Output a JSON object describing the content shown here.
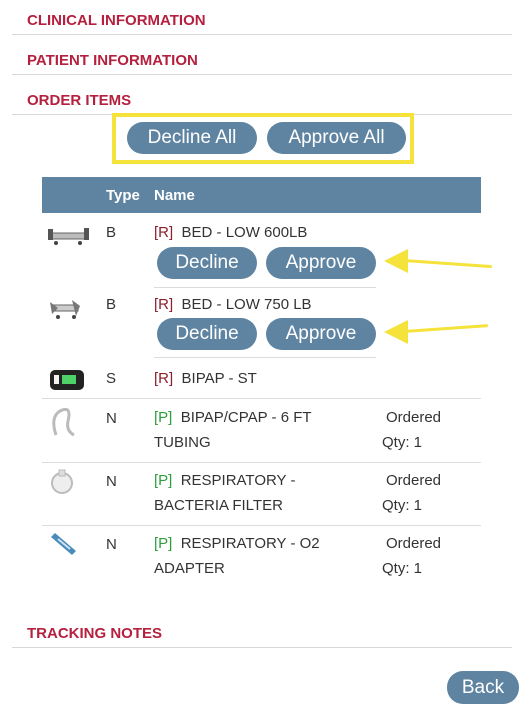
{
  "sections": {
    "clinical": "CLINICAL INFORMATION",
    "patient": "PATIENT INFORMATION",
    "order_items": "ORDER ITEMS",
    "tracking": "TRACKING NOTES"
  },
  "bulk_actions": {
    "decline_all": "Decline All",
    "approve_all": "Approve All"
  },
  "table": {
    "headers": {
      "type": "Type",
      "name": "Name"
    },
    "rows": [
      {
        "type": "B",
        "tag": "[R]",
        "name_line1": "BED - LOW 600LB",
        "name_line2": "",
        "status": "",
        "qty": "",
        "decline": "Decline",
        "approve": "Approve"
      },
      {
        "type": "B",
        "tag": "[R]",
        "name_line1": "BED - LOW 750 LB",
        "name_line2": "",
        "status": "",
        "qty": "",
        "decline": "Decline",
        "approve": "Approve"
      },
      {
        "type": "S",
        "tag": "[R]",
        "name_line1": "BIPAP - ST",
        "name_line2": "",
        "status": "",
        "qty": ""
      },
      {
        "type": "N",
        "tag": "[P]",
        "name_line1": "BIPAP/CPAP - 6 FT",
        "name_line2": "TUBING",
        "status": "Ordered",
        "qty": "Qty: 1"
      },
      {
        "type": "N",
        "tag": "[P]",
        "name_line1": "RESPIRATORY -",
        "name_line2": "BACTERIA FILTER",
        "status": "Ordered",
        "qty": "Qty: 1"
      },
      {
        "type": "N",
        "tag": "[P]",
        "name_line1": "RESPIRATORY - O2",
        "name_line2": "ADAPTER",
        "status": "Ordered",
        "qty": "Qty: 1"
      }
    ]
  },
  "footer": {
    "back": "Back"
  },
  "colors": {
    "accent": "#5f84a2",
    "section": "#b5203f",
    "highlight": "#f5e23a",
    "tag_r": "#8b1f2b",
    "tag_p": "#2e9e3d"
  }
}
